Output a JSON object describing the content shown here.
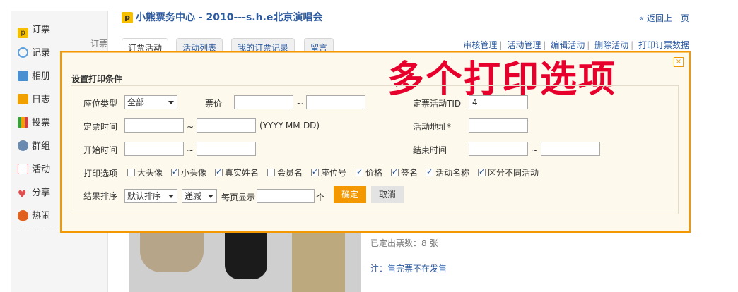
{
  "sidebar": {
    "items": [
      {
        "label": "订票",
        "icon": "ticket-icon",
        "color": "#f5c000"
      },
      {
        "label": "记录",
        "icon": "speech-bubble-icon",
        "color": "#5aa0e0"
      },
      {
        "label": "相册",
        "icon": "photo-album-icon",
        "color": "#4a8fd0"
      },
      {
        "label": "日志",
        "icon": "journal-icon",
        "color": "#f0a000"
      },
      {
        "label": "投票",
        "icon": "vote-chart-icon",
        "color": "#3a9f3a"
      },
      {
        "label": "群组",
        "icon": "group-icon",
        "color": "#6a8ab0"
      },
      {
        "label": "活动",
        "icon": "calendar-icon",
        "color": "#d04040"
      },
      {
        "label": "分享",
        "icon": "heart-icon",
        "color": "#e05050"
      },
      {
        "label": "热闹",
        "icon": "fire-icon",
        "color": "#e06020"
      }
    ],
    "extra_label": "订票"
  },
  "header": {
    "badge": "p",
    "title": "小熊票务中心 - 2010---s.h.e北京演唱会",
    "back": "« 返回上一页"
  },
  "tabs": [
    "订票活动",
    "活动列表",
    "我的订票记录",
    "留言"
  ],
  "tools": [
    "审核管理",
    "活动管理",
    "编辑活动",
    "删除活动",
    "打印订票数据"
  ],
  "caption": "多个打印选项",
  "dialog": {
    "title": "设置打印条件",
    "close": "×",
    "seat_type_label": "座位类型",
    "seat_type_value": "全部",
    "price_label": "票价",
    "tilde": "~",
    "tid_label": "定票活动TID",
    "tid_value": "4",
    "book_time_label": "定票时间",
    "date_format": "(YYYY-MM-DD)",
    "address_label": "活动地址*",
    "start_time_label": "开始时间",
    "end_time_label": "结束时间",
    "print_options_label": "打印选项",
    "options": [
      {
        "label": "大头像",
        "checked": false
      },
      {
        "label": "小头像",
        "checked": true
      },
      {
        "label": "真实姓名",
        "checked": true
      },
      {
        "label": "会员名",
        "checked": false
      },
      {
        "label": "座位号",
        "checked": true
      },
      {
        "label": "价格",
        "checked": true
      },
      {
        "label": "签名",
        "checked": true
      },
      {
        "label": "活动名称",
        "checked": true
      },
      {
        "label": "区分不同活动",
        "checked": true
      }
    ],
    "sort_label": "结果排序",
    "sort_value": "默认排序",
    "order_value": "递减",
    "per_page_label": "每页显示",
    "unit": "个",
    "ok": "确定",
    "cancel": "取消"
  },
  "info": {
    "sold": "已定出票数：8 张",
    "note": "注：售完票不在发售"
  },
  "colors": {
    "accent": "#f39800",
    "link": "#2b5aa0",
    "caption": "#e8002c"
  }
}
